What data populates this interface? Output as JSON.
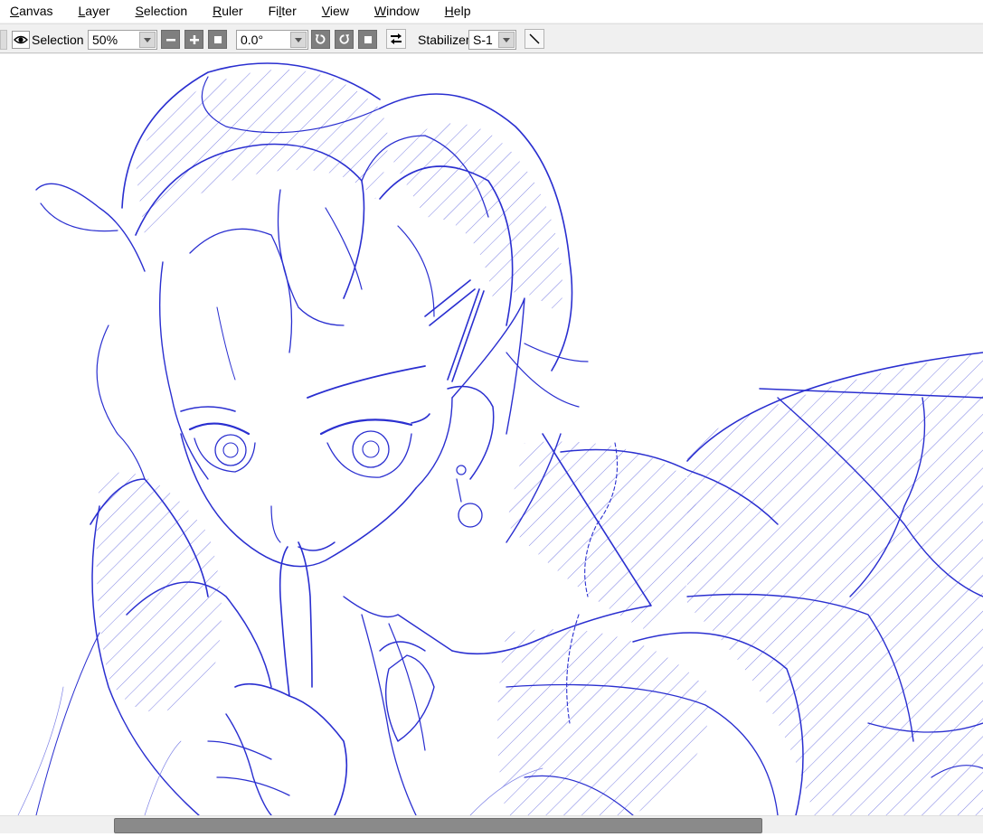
{
  "menu": [
    "Canvas",
    "Layer",
    "Selection",
    "Ruler",
    "Filter",
    "View",
    "Window",
    "Help"
  ],
  "toolbar": {
    "selection_label": "Selection",
    "zoom_value": "50%",
    "rotation_value": "0.0°",
    "stabilizer_label": "Stabilizer",
    "stabilizer_value": "S-1"
  },
  "canvas": {
    "content": "line-art-sketch",
    "line_color": "#2a2fd0"
  },
  "scrollbar": {
    "position": 0.34,
    "visible_fraction": 0.66
  },
  "colors": {
    "menubar_bg": "#ffffff",
    "toolbar_bg": "#f0f0f0",
    "canvas_bg": "#ffffff",
    "scroll_thumb": "#8a8a8a"
  }
}
